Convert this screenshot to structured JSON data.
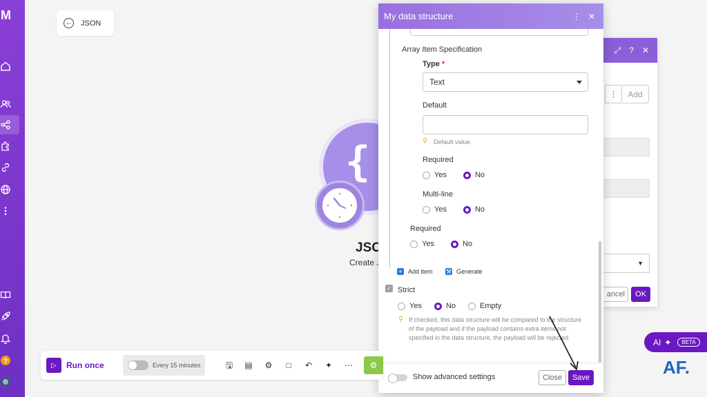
{
  "sidebar": {
    "logo_text": "M",
    "items": [
      {
        "name": "home-icon"
      },
      {
        "name": "users-icon"
      },
      {
        "name": "share-icon"
      },
      {
        "name": "puzzle-icon"
      },
      {
        "name": "link-icon"
      },
      {
        "name": "globe-icon"
      },
      {
        "name": "more-icon"
      },
      {
        "name": "book-icon"
      },
      {
        "name": "rocket-icon"
      },
      {
        "name": "bell-icon"
      },
      {
        "name": "help-icon"
      },
      {
        "name": "avatar-icon"
      }
    ]
  },
  "back_card": {
    "label": "JSON"
  },
  "module": {
    "title": "JSO",
    "subtitle": "Create J"
  },
  "bg_dialog": {
    "add_label": "Add",
    "cancel_label": "ancel",
    "ok_label": "OK",
    "header_icons": [
      "expand-icon",
      "help-icon",
      "close-icon"
    ]
  },
  "dialog": {
    "title": "My data structure",
    "section_title": "Array Item Specification",
    "type_label": "Type",
    "type_required_mark": "*",
    "type_value": "Text",
    "default_label": "Default",
    "default_value": "",
    "default_hint": "Default value.",
    "required_label": "Required",
    "multiline_label": "Multi-line",
    "outer_required_label": "Required",
    "yes": "Yes",
    "no": "No",
    "empty": "Empty",
    "add_item": "Add item",
    "generate": "Generate",
    "strict_label": "Strict",
    "strict_hint": "If checked, this data structure will be compared to the structure of the payload and if the payload contains extra items not specified in the data structure, the payload will be rejected.",
    "show_advanced": "Show advanced settings",
    "close_label": "Close",
    "save_label": "Save",
    "selections": {
      "required": "No",
      "multiline": "No",
      "outer_required": "No",
      "strict": "No"
    }
  },
  "toolbar": {
    "run_once": "Run once",
    "schedule": "Every 15 minutes",
    "icons": [
      "save-icon",
      "blueprint-icon",
      "settings-icon",
      "notes-icon",
      "undo-icon",
      "magic-wand-icon",
      "more-icon"
    ]
  },
  "ai": {
    "label": "AI",
    "badge": "BETA"
  },
  "watermark": "AF.",
  "colors": {
    "accent": "#6a19c2",
    "header_purple": "#9a6fe0",
    "sidebar_purple": "#7a35cc",
    "watermark_blue": "#1f66c1"
  }
}
